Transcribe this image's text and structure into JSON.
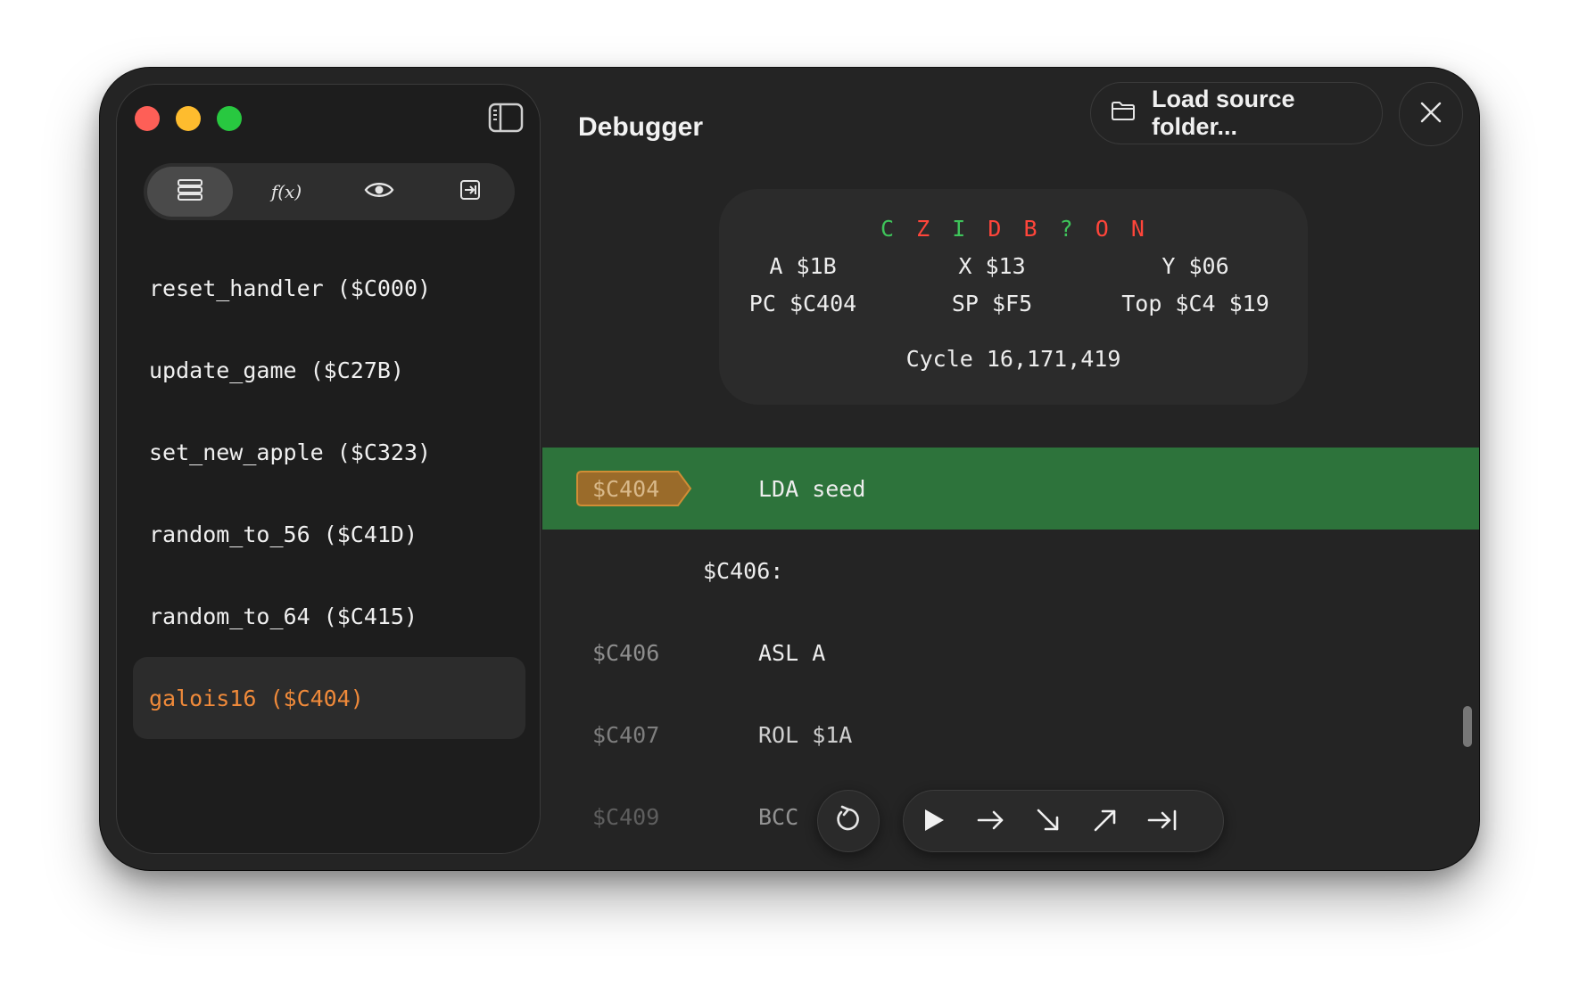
{
  "window": {
    "title": "Debugger"
  },
  "sidebar": {
    "tabs": [
      {
        "name": "symbols",
        "icon": "list-icon",
        "active": true
      },
      {
        "name": "functions",
        "label": "f(x)",
        "icon": "function-icon",
        "active": false
      },
      {
        "name": "watch",
        "icon": "eye-icon",
        "active": false
      },
      {
        "name": "breakpoints",
        "icon": "step-to-icon",
        "active": false
      }
    ],
    "symbols": [
      {
        "label": "reset_handler ($C000)",
        "selected": false
      },
      {
        "label": "update_game ($C27B)",
        "selected": false
      },
      {
        "label": "set_new_apple ($C323)",
        "selected": false
      },
      {
        "label": "random_to_56 ($C41D)",
        "selected": false
      },
      {
        "label": "random_to_64 ($C415)",
        "selected": false
      },
      {
        "label": "galois16 ($C404)",
        "selected": true
      }
    ]
  },
  "header": {
    "load_label": "Load source folder...",
    "load_icon": "folder-icon",
    "close_icon": "close-icon"
  },
  "registers": {
    "flags": [
      {
        "letter": "C",
        "color": "#3ec45a"
      },
      {
        "letter": "Z",
        "color": "#ff453a"
      },
      {
        "letter": "I",
        "color": "#3ec45a"
      },
      {
        "letter": "D",
        "color": "#ff453a"
      },
      {
        "letter": "B",
        "color": "#ff453a"
      },
      {
        "letter": "?",
        "color": "#3ec45a"
      },
      {
        "letter": "O",
        "color": "#ff453a"
      },
      {
        "letter": "N",
        "color": "#ff453a"
      }
    ],
    "a": "A $1B",
    "x": "X $13",
    "y": "Y $06",
    "pc": "PC $C404",
    "sp": "SP $F5",
    "top": "Top $C4 $19",
    "cycle": "Cycle 16,171,419"
  },
  "code": {
    "current": {
      "addr": "$C404",
      "instr": "LDA seed"
    },
    "label": "$C406:",
    "rows": [
      {
        "addr": "$C406",
        "instr": "ASL A"
      },
      {
        "addr": "$C407",
        "instr": "ROL $1A"
      },
      {
        "addr": "$C409",
        "instr": "BCC"
      }
    ]
  },
  "controls": {
    "restart_icon": "restart-icon",
    "buttons": [
      "play-icon",
      "step-over-icon",
      "step-into-icon",
      "step-out-icon",
      "run-to-cursor-icon"
    ]
  },
  "colors": {
    "current_line": "#2d733b",
    "selected_symbol": "#f08a3a",
    "pc_tag": "#9a6b2a"
  }
}
